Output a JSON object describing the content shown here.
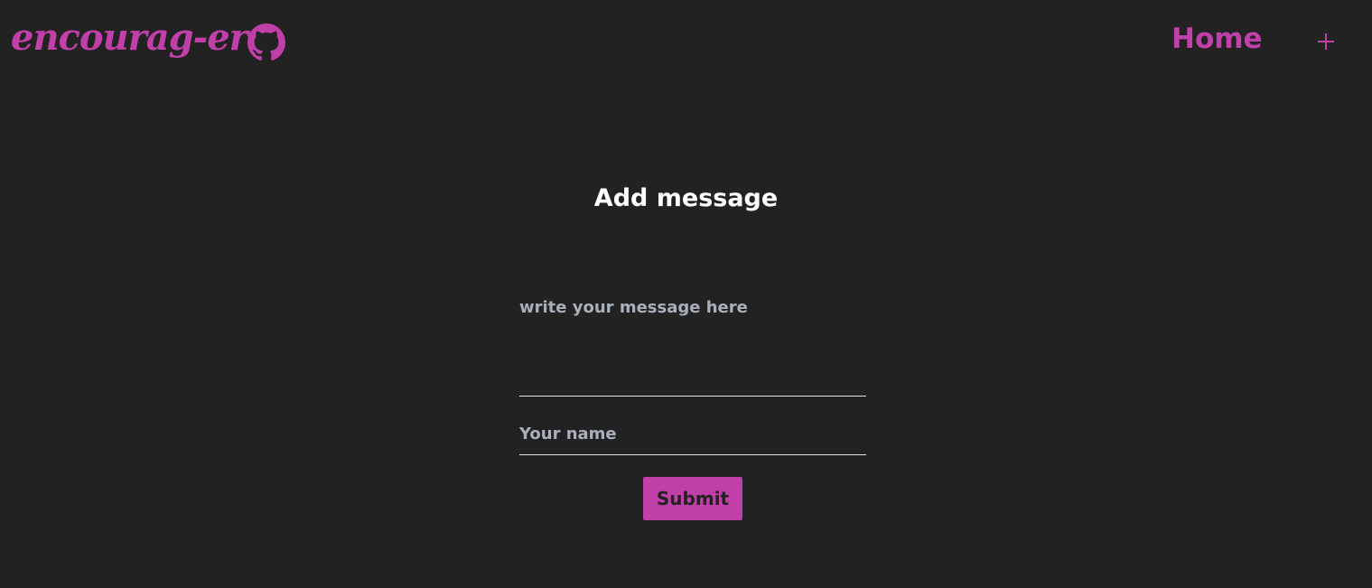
{
  "navbar": {
    "brand": "encourag-er",
    "github_icon": "github-icon",
    "home_label": "Home",
    "add_icon": "plus-icon"
  },
  "form": {
    "title": "Add message",
    "message_placeholder": "write your message here",
    "message_value": "",
    "name_placeholder": "Your name",
    "name_value": "",
    "submit_label": "Submit"
  },
  "colors": {
    "background": "#222222",
    "accent": "#c13fa8",
    "title_text": "#ffffff",
    "placeholder_text": "#a9b0ba",
    "underline": "#e6e6e6"
  }
}
